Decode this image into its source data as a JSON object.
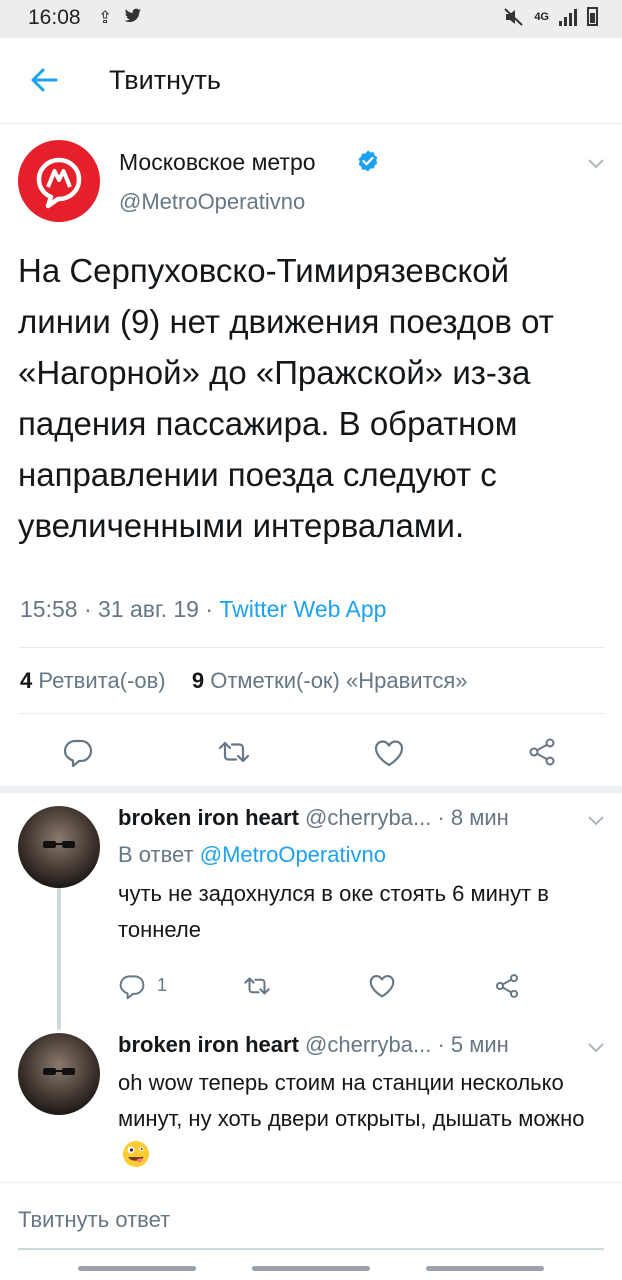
{
  "status_bar": {
    "time": "16:08",
    "network": "4G"
  },
  "header": {
    "title": "Твитнуть"
  },
  "tweet": {
    "author_name": "Московское метро",
    "author_handle": "@MetroOperativno",
    "text": "На Серпуховско-Тимирязевской линии (9) нет движения поездов от «Нагорной» до «Пражской» из-за падения пассажира. В обратном направлении поезда следуют с увеличенными интервалами.",
    "time": "15:58",
    "date": "31 авг. 19",
    "source": "Twitter Web App",
    "retweets_count": "4",
    "retweets_label": "Ретвита(-ов)",
    "likes_count": "9",
    "likes_label": "Отметки(-ок) «Нравится»"
  },
  "replies": [
    {
      "name": "broken iron heart",
      "handle": "@cherryba...",
      "time": "8 мин",
      "in_reply_prefix": "В ответ",
      "in_reply_to": "@MetroOperativno",
      "text": "чуть не задохнулся в оке стоять 6 минут в тоннеле",
      "reply_count": "1"
    },
    {
      "name": "broken iron heart",
      "handle": "@cherryba...",
      "time": "5 мин",
      "text": "oh wow теперь стоим на станции несколько минут, ну хоть двери открыты, дышать можно"
    }
  ],
  "compose": {
    "placeholder": "Твитнуть ответ"
  },
  "colors": {
    "accent": "#1da1f2",
    "metro_red": "#e5202a",
    "muted": "#657786"
  },
  "icons": [
    "back-arrow-icon",
    "verified-icon",
    "chevron-down-icon",
    "reply-icon",
    "retweet-icon",
    "like-icon",
    "share-icon",
    "metro-logo-icon",
    "zany-face-emoji"
  ]
}
